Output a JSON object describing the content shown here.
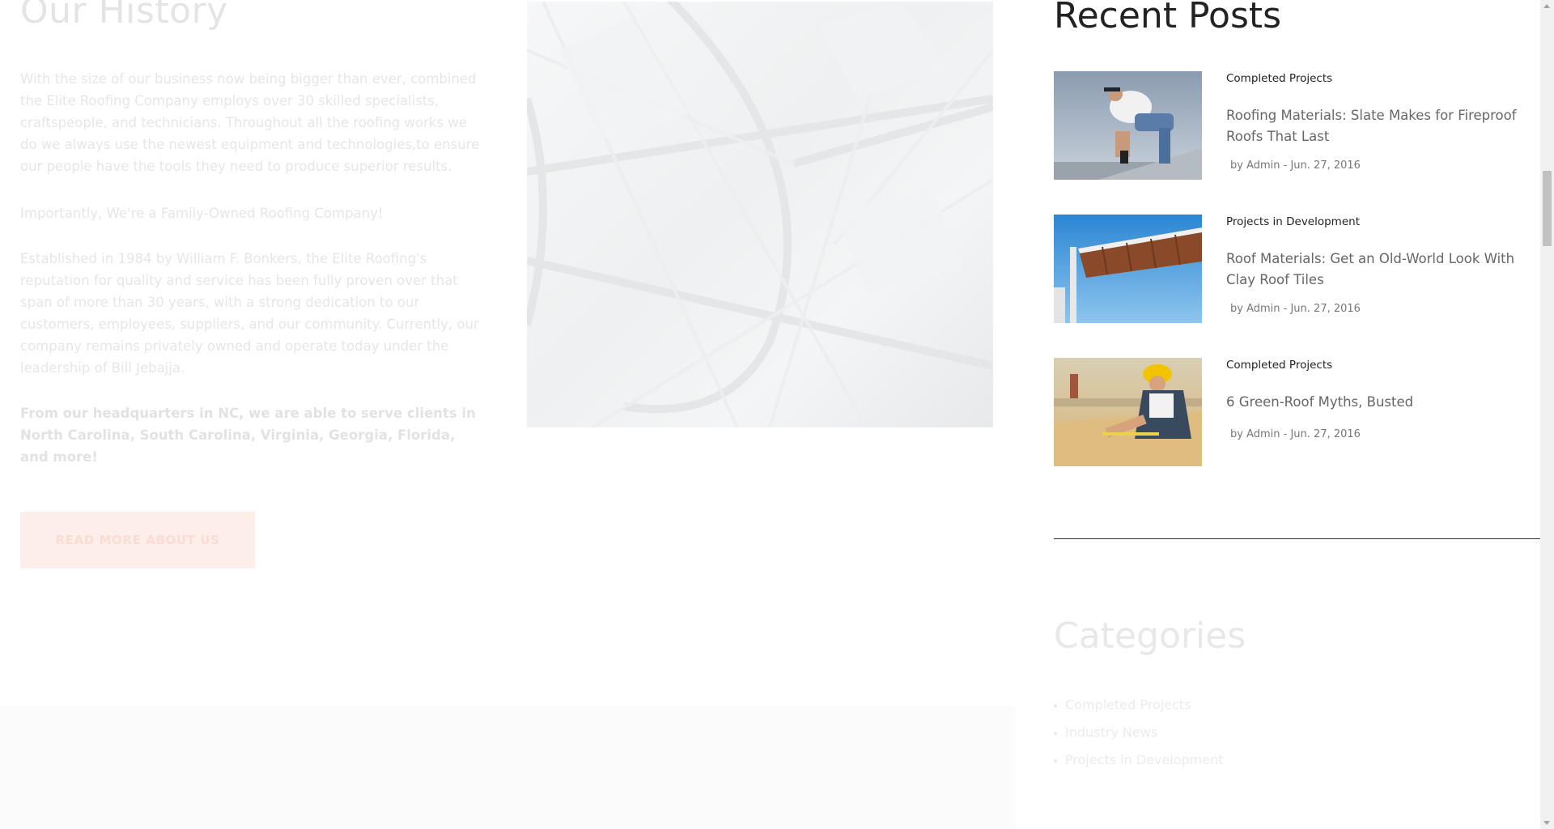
{
  "history": {
    "title": "Our History",
    "paragraph1": "With the size of our business now being bigger than ever, combined the Elite Roofing Company employs over 30 skilled specialists, craftspeople, and technicians. Throughout all the roofing works we do we always use the newest equipment and technologies,to ensure our people have the tools they need to produce superior results.",
    "paragraph2": "Importantly, We're a Family-Owned Roofing Company!",
    "paragraph3": "Established in 1984 by William F. Bonkers, the Elite Roofing's reputation for quality and service has been fully proven over that span of more than 30 years, with a strong dedication to our customers, employees, suppliers, and our community. Currently, our company remains privately owned and operate today under the leadership of Bill Jebajja.",
    "paragraph4": "From our headquarters in NC, we are able to serve clients in North Carolina, South Carolina, Virginia, Georgia, Florida, and more!",
    "button_label": "READ MORE ABOUT US"
  },
  "sidebar": {
    "recent_posts_title": "Recent Posts",
    "posts": [
      {
        "category": "Completed Projects",
        "title": "Roofing Materials: Slate Makes for Fireproof Roofs That Last",
        "byline": "by Admin - Jun. 27, 2016"
      },
      {
        "category": "Projects in Development",
        "title": "Roof Materials: Get an Old-World Look With Clay Roof Tiles",
        "byline": "by Admin - Jun. 27, 2016"
      },
      {
        "category": "Completed Projects",
        "title": "6 Green-Roof Myths, Busted",
        "byline": "by Admin - Jun. 27, 2016"
      }
    ],
    "categories_title": "Categories",
    "categories": [
      "Completed Projects",
      "Industry News",
      "Projects in Development"
    ]
  },
  "colors": {
    "heading_dark": "#222222",
    "post_title": "#666666",
    "button_bg": "#fdeeea",
    "faded_text": "#e6e6e6"
  },
  "icons": {
    "scroll_up": "chevron-up-icon",
    "scroll_down": "chevron-down-icon",
    "bullet": "bullet-icon"
  }
}
